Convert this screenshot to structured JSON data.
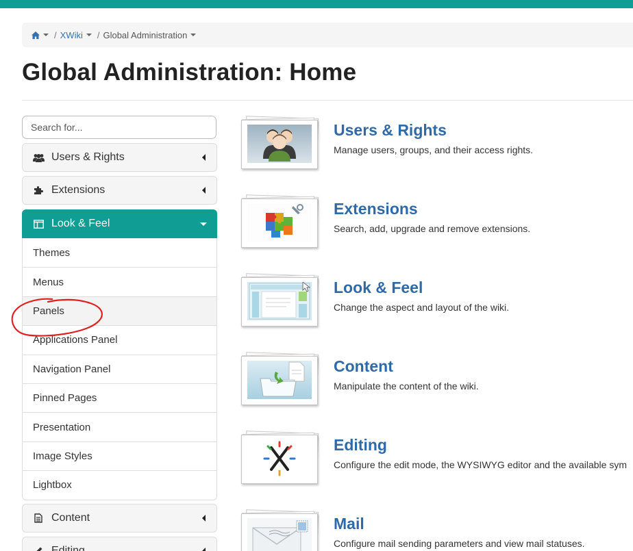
{
  "breadcrumb": {
    "home_icon": "home-icon",
    "items": [
      "XWiki",
      "Global Administration"
    ],
    "separator": "/"
  },
  "page": {
    "title": "Global Administration: Home"
  },
  "sidebar": {
    "search_placeholder": "Search for...",
    "panels": [
      {
        "label": "Users & Rights",
        "icon": "users-icon",
        "state": "collapsed"
      },
      {
        "label": "Extensions",
        "icon": "puzzle-icon",
        "state": "collapsed"
      },
      {
        "label": "Look & Feel",
        "icon": "layout-icon",
        "state": "expanded"
      },
      {
        "label": "Content",
        "icon": "document-icon",
        "state": "collapsed"
      },
      {
        "label": "Editing",
        "icon": "pencil-icon",
        "state": "collapsed"
      }
    ],
    "look_feel_items": [
      "Themes",
      "Menus",
      "Panels",
      "Applications Panel",
      "Navigation Panel",
      "Pinned Pages",
      "Presentation",
      "Image Styles",
      "Lightbox"
    ],
    "highlighted_item": "Panels"
  },
  "sections": [
    {
      "title": "Users & Rights",
      "description": "Manage users, groups, and their access rights.",
      "icon": "users-group-icon"
    },
    {
      "title": "Extensions",
      "description": "Search, add, upgrade and remove extensions.",
      "icon": "extensions-puzzle-icon"
    },
    {
      "title": "Look & Feel",
      "description": "Change the aspect and layout of the wiki.",
      "icon": "look-feel-layout-icon"
    },
    {
      "title": "Content",
      "description": "Manipulate the content of the wiki.",
      "icon": "content-folder-icon"
    },
    {
      "title": "Editing",
      "description": "Configure the edit mode, the WYSIWYG editor and the available sym",
      "icon": "editing-x-icon"
    },
    {
      "title": "Mail",
      "description": "Configure mail sending parameters and view mail statuses.",
      "icon": "mail-envelope-icon"
    }
  ],
  "colors": {
    "brand": "#0f9d94",
    "link": "#2f6aa8",
    "annotation": "#e02020"
  }
}
